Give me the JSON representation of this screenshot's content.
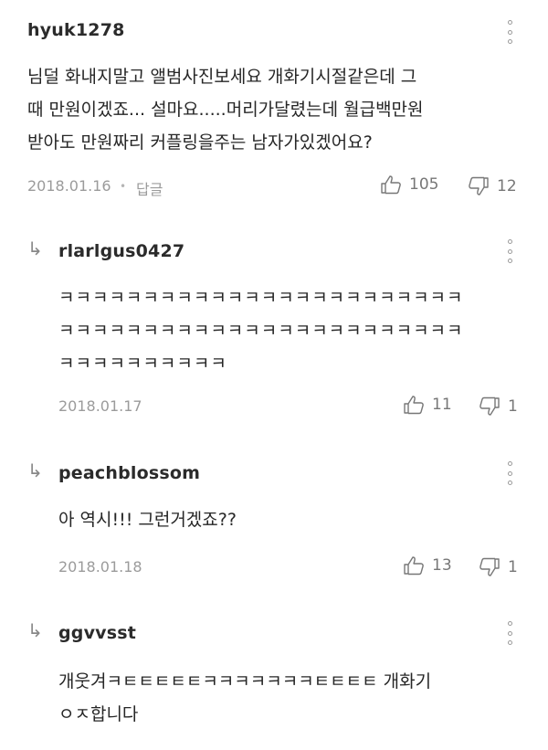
{
  "comments": [
    {
      "username": "hyuk1278",
      "text": "님덜 화내지말고 앨범사진보세요 개화기시절같은데 그\n때 만원이겠죠... 설마요.....머리가달렸는데 월급백만원\n받아도 만원짜리 커플링을주는 남자가있겠어요?",
      "date": "2018.01.16",
      "reply_label": "답글",
      "likes": "105",
      "dislikes": "12"
    },
    {
      "username": "rlarlgus0427",
      "text": "ㅋㅋㅋㅋㅋㅋㅋㅋㅋㅋㅋㅋㅋㅋㅋㅋㅋㅋㅋㅋㅋㅋㅋㅋ\nㅋㅋㅋㅋㅋㅋㅋㅋㅋㅋㅋㅋㅋㅋㅋㅋㅋㅋㅋㅋㅋㅋㅋㅋ\nㅋㅋㅋㅋㅋㅋㅋㅋㅋㅋ",
      "date": "2018.01.17",
      "likes": "11",
      "dislikes": "1"
    },
    {
      "username": "peachblossom",
      "text": "아 역시!!! 그런거겠죠??",
      "date": "2018.01.18",
      "likes": "13",
      "dislikes": "1"
    },
    {
      "username": "ggvvsst",
      "text": "개웃겨ㅋㅌㅌㅌㅌㅌㅋㅋㅋㅋㅋㅋㅋㅌㅌㅌㅌ 개화기\nㅇㅈ합니다"
    }
  ],
  "reply_arrow": "↳",
  "icons": {
    "like": "thumbs-up-icon",
    "dislike": "thumbs-down-icon",
    "more": "more-vertical-icon"
  }
}
